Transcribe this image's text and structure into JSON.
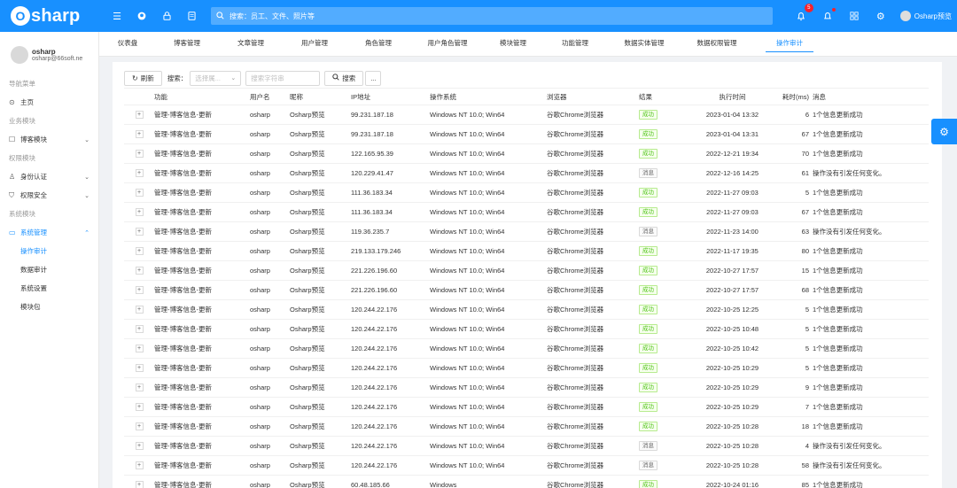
{
  "app": {
    "logo_letter": "O",
    "logo_text": "sharp",
    "search_placeholder": "搜索：员工、文件、照片等",
    "notifications_count": "5",
    "user_name": "Osharp预览"
  },
  "sidebar": {
    "profile": {
      "name": "osharp",
      "email": "osharp@66soft.ne"
    },
    "sections": {
      "nav": "导航菜单",
      "home": "主页",
      "business": "业务模块",
      "blog": "博客模块",
      "permission": "权限模块",
      "identity": "身份认证",
      "security": "权限安全",
      "system": "系统模块",
      "system_admin": "系统管理"
    },
    "sub_items": [
      "操作审计",
      "数据审计",
      "系统设置",
      "模块包"
    ]
  },
  "tabs": [
    "仪表盘",
    "博客管理",
    "文章管理",
    "用户管理",
    "角色管理",
    "用户角色管理",
    "模块管理",
    "功能管理",
    "数据实体管理",
    "数据权限管理",
    "操作审计"
  ],
  "toolbar": {
    "refresh": "刷新",
    "search_label": "搜索：",
    "select_placeholder": "选择属...",
    "input_placeholder": "搜索字符串",
    "search_button": "搜索",
    "more": "..."
  },
  "table": {
    "headers": [
      "",
      "功能",
      "用户名",
      "昵称",
      "IP地址",
      "操作系统",
      "浏览器",
      "结果",
      "执行时间",
      "耗时(ms)",
      "消息"
    ],
    "rows": [
      [
        "管理-博客信息-更新",
        "osharp",
        "Osharp预览",
        "99.231.187.18",
        "Windows NT 10.0; Win64",
        "谷歌Chrome浏览器",
        "成功",
        "2023-01-04 13:32",
        "6",
        "1个信息更新成功"
      ],
      [
        "管理-博客信息-更新",
        "osharp",
        "Osharp预览",
        "99.231.187.18",
        "Windows NT 10.0; Win64",
        "谷歌Chrome浏览器",
        "成功",
        "2023-01-04 13:31",
        "67",
        "1个信息更新成功"
      ],
      [
        "管理-博客信息-更新",
        "osharp",
        "Osharp预览",
        "122.165.95.39",
        "Windows NT 10.0; Win64",
        "谷歌Chrome浏览器",
        "成功",
        "2022-12-21 19:34",
        "70",
        "1个信息更新成功"
      ],
      [
        "管理-博客信息-更新",
        "osharp",
        "Osharp预览",
        "120.229.41.47",
        "Windows NT 10.0; Win64",
        "谷歌Chrome浏览器",
        "消息",
        "2022-12-16 14:25",
        "61",
        "操作没有引发任何变化。"
      ],
      [
        "管理-博客信息-更新",
        "osharp",
        "Osharp预览",
        "111.36.183.34",
        "Windows NT 10.0; Win64",
        "谷歌Chrome浏览器",
        "成功",
        "2022-11-27 09:03",
        "5",
        "1个信息更新成功"
      ],
      [
        "管理-博客信息-更新",
        "osharp",
        "Osharp预览",
        "111.36.183.34",
        "Windows NT 10.0; Win64",
        "谷歌Chrome浏览器",
        "成功",
        "2022-11-27 09:03",
        "67",
        "1个信息更新成功"
      ],
      [
        "管理-博客信息-更新",
        "osharp",
        "Osharp预览",
        "119.36.235.7",
        "Windows NT 10.0; Win64",
        "谷歌Chrome浏览器",
        "消息",
        "2022-11-23 14:00",
        "63",
        "操作没有引发任何变化。"
      ],
      [
        "管理-博客信息-更新",
        "osharp",
        "Osharp预览",
        "219.133.179.246",
        "Windows NT 10.0; Win64",
        "谷歌Chrome浏览器",
        "成功",
        "2022-11-17 19:35",
        "80",
        "1个信息更新成功"
      ],
      [
        "管理-博客信息-更新",
        "osharp",
        "Osharp预览",
        "221.226.196.60",
        "Windows NT 10.0; Win64",
        "谷歌Chrome浏览器",
        "成功",
        "2022-10-27 17:57",
        "15",
        "1个信息更新成功"
      ],
      [
        "管理-博客信息-更新",
        "osharp",
        "Osharp预览",
        "221.226.196.60",
        "Windows NT 10.0; Win64",
        "谷歌Chrome浏览器",
        "成功",
        "2022-10-27 17:57",
        "68",
        "1个信息更新成功"
      ],
      [
        "管理-博客信息-更新",
        "osharp",
        "Osharp预览",
        "120.244.22.176",
        "Windows NT 10.0; Win64",
        "谷歌Chrome浏览器",
        "成功",
        "2022-10-25 12:25",
        "5",
        "1个信息更新成功"
      ],
      [
        "管理-博客信息-更新",
        "osharp",
        "Osharp预览",
        "120.244.22.176",
        "Windows NT 10.0; Win64",
        "谷歌Chrome浏览器",
        "成功",
        "2022-10-25 10:48",
        "5",
        "1个信息更新成功"
      ],
      [
        "管理-博客信息-更新",
        "osharp",
        "Osharp预览",
        "120.244.22.176",
        "Windows NT 10.0; Win64",
        "谷歌Chrome浏览器",
        "成功",
        "2022-10-25 10:42",
        "5",
        "1个信息更新成功"
      ],
      [
        "管理-博客信息-更新",
        "osharp",
        "Osharp预览",
        "120.244.22.176",
        "Windows NT 10.0; Win64",
        "谷歌Chrome浏览器",
        "成功",
        "2022-10-25 10:29",
        "5",
        "1个信息更新成功"
      ],
      [
        "管理-博客信息-更新",
        "osharp",
        "Osharp预览",
        "120.244.22.176",
        "Windows NT 10.0; Win64",
        "谷歌Chrome浏览器",
        "成功",
        "2022-10-25 10:29",
        "9",
        "1个信息更新成功"
      ],
      [
        "管理-博客信息-更新",
        "osharp",
        "Osharp预览",
        "120.244.22.176",
        "Windows NT 10.0; Win64",
        "谷歌Chrome浏览器",
        "成功",
        "2022-10-25 10:29",
        "7",
        "1个信息更新成功"
      ],
      [
        "管理-博客信息-更新",
        "osharp",
        "Osharp预览",
        "120.244.22.176",
        "Windows NT 10.0; Win64",
        "谷歌Chrome浏览器",
        "成功",
        "2022-10-25 10:28",
        "18",
        "1个信息更新成功"
      ],
      [
        "管理-博客信息-更新",
        "osharp",
        "Osharp预览",
        "120.244.22.176",
        "Windows NT 10.0; Win64",
        "谷歌Chrome浏览器",
        "消息",
        "2022-10-25 10:28",
        "4",
        "操作没有引发任何变化。"
      ],
      [
        "管理-博客信息-更新",
        "osharp",
        "Osharp预览",
        "120.244.22.176",
        "Windows NT 10.0; Win64",
        "谷歌Chrome浏览器",
        "消息",
        "2022-10-25 10:28",
        "58",
        "操作没有引发任何变化。"
      ],
      [
        "管理-博客信息-更新",
        "osharp",
        "Osharp预览",
        "60.48.185.66",
        "Windows",
        "谷歌Chrome浏览器",
        "成功",
        "2022-10-24 01:16",
        "85",
        "1个信息更新成功"
      ]
    ]
  },
  "colors": {
    "primary": "#1890ff",
    "success": "#52c41a"
  }
}
